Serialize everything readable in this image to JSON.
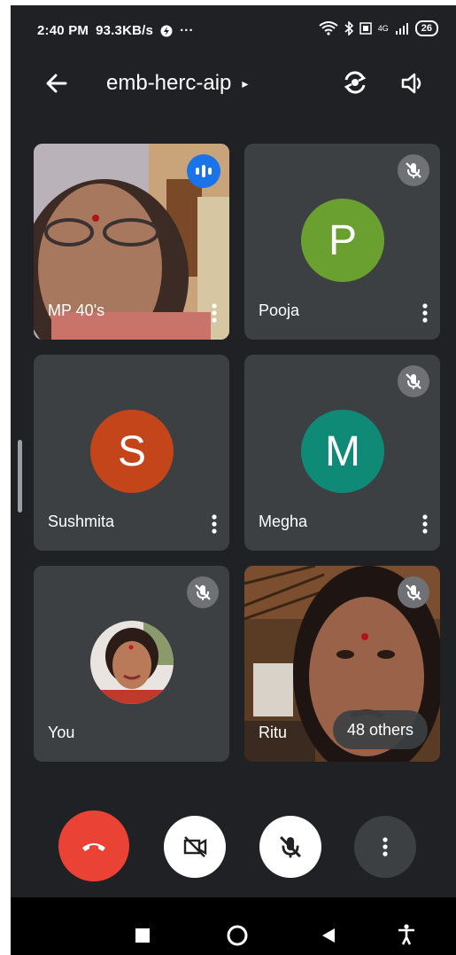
{
  "status_bar": {
    "time": "2:40 PM",
    "speed": "93.3KB/s",
    "more": "···",
    "signal": "4G",
    "battery": "26"
  },
  "header": {
    "meeting_code": "emb-herc-aip",
    "expand_caret": "▸"
  },
  "participants": [
    {
      "name": "MP 40's",
      "type": "video",
      "speaking": true
    },
    {
      "name": "Pooja",
      "initial": "P",
      "avatar_color": "#6aa030",
      "muted": true
    },
    {
      "name": "Sushmita",
      "initial": "S",
      "avatar_color": "#c5451a",
      "muted": false
    },
    {
      "name": "Megha",
      "initial": "M",
      "avatar_color": "#0f8a77",
      "muted": true
    },
    {
      "name": "You",
      "type": "photo",
      "muted": true
    },
    {
      "name": "Ritu",
      "type": "video",
      "muted": true
    }
  ],
  "others_badge": "48 others",
  "colors": {
    "background": "#202124",
    "tile": "#3c4043",
    "end_call": "#ea4335",
    "speaking": "#1a73e8"
  }
}
